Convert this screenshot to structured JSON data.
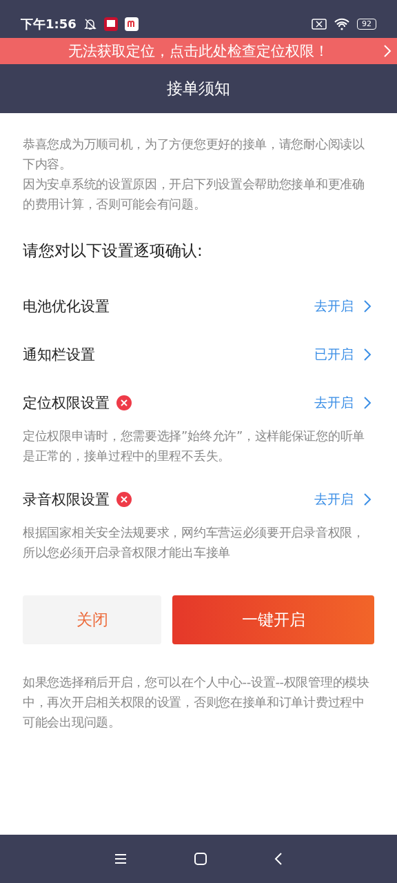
{
  "status_bar": {
    "time": "下午1:56",
    "battery": "92"
  },
  "banner": {
    "text": "无法获取定位，点击此处检查定位权限！"
  },
  "header": {
    "title": "接单须知"
  },
  "intro": [
    "恭喜您成为万顺司机，为了方便您更好的接单，请您耐心阅读以下内容。",
    "因为安卓系统的设置原因，开启下列设置会帮助您接单和更准确的费用计算，否则可能会有问题。"
  ],
  "heading": "请您对以下设置逐项确认:",
  "settings": [
    {
      "label": "电池优化设置",
      "error": false,
      "action": "去开启"
    },
    {
      "label": "通知栏设置",
      "error": false,
      "action": "已开启"
    },
    {
      "label": "定位权限设置",
      "error": true,
      "action": "去开启",
      "note": "定位权限申请时，您需要选择”始终允许”，这样能保证您的听单是正常的，接单过程中的里程不丢失。"
    },
    {
      "label": "录音权限设置",
      "error": true,
      "action": "去开启",
      "note": "根据国家相关安全法规要求，网约车营运必须要开启录音权限，所以您必须开启录音权限才能出车接单"
    }
  ],
  "buttons": [
    {
      "label": "关闭",
      "kind": "secondary"
    },
    {
      "label": "一键开启",
      "kind": "primary"
    }
  ],
  "footer": "如果您选择稍后开启，您可以在个人中心--设置--权限管理的模块中，再次开启相关权限的设置，否则您在接单和订单计费过程中可能会出现问题。"
}
